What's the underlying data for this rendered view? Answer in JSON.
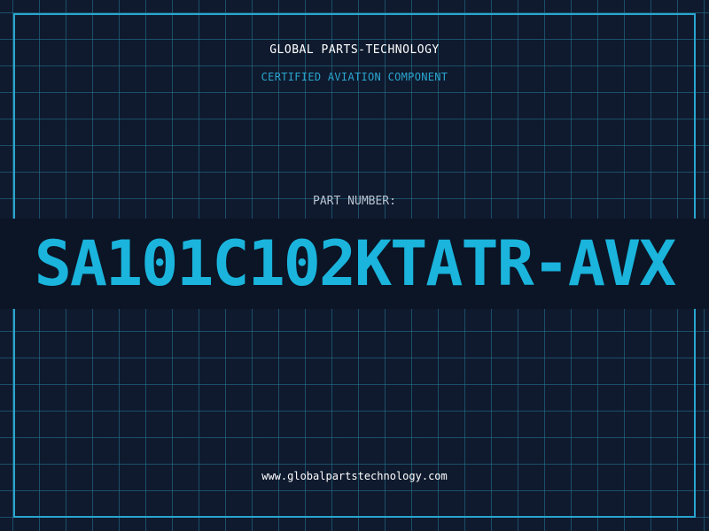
{
  "header": {
    "company_name": "GLOBAL PARTS-TECHNOLOGY",
    "subtitle": "CERTIFIED AVIATION COMPONENT"
  },
  "part": {
    "label": "PART NUMBER:",
    "number": "SA101C102KTATR-AVX"
  },
  "footer": {
    "website": "www.globalpartstechnology.com"
  },
  "colors": {
    "background": "#0f1a2e",
    "accent": "#2aa5cf",
    "part_number": "#1ab4dc",
    "heading": "#ffffff",
    "label": "#b8c2d0"
  }
}
